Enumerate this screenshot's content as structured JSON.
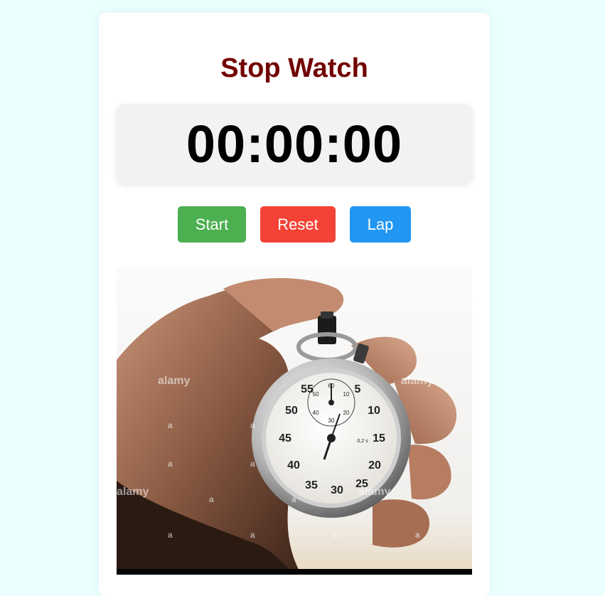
{
  "app": {
    "title": "Stop Watch",
    "time": "00:00:00"
  },
  "controls": {
    "start_label": "Start",
    "reset_label": "Reset",
    "lap_label": "Lap"
  },
  "image": {
    "watermark_text": "alamy",
    "watermark_letter": "a",
    "dial_numbers": [
      "55",
      "5",
      "50",
      "10",
      "45",
      "15",
      "40",
      "20",
      "35",
      "30",
      "25"
    ],
    "subdial_numbers": [
      "60",
      "50",
      "10",
      "40",
      "20",
      "30"
    ],
    "dial_marking": "0,2 s"
  },
  "colors": {
    "page_background": "#eafffe",
    "title": "#720000",
    "start": "#4caf50",
    "reset": "#f44336",
    "lap": "#2196f3"
  }
}
